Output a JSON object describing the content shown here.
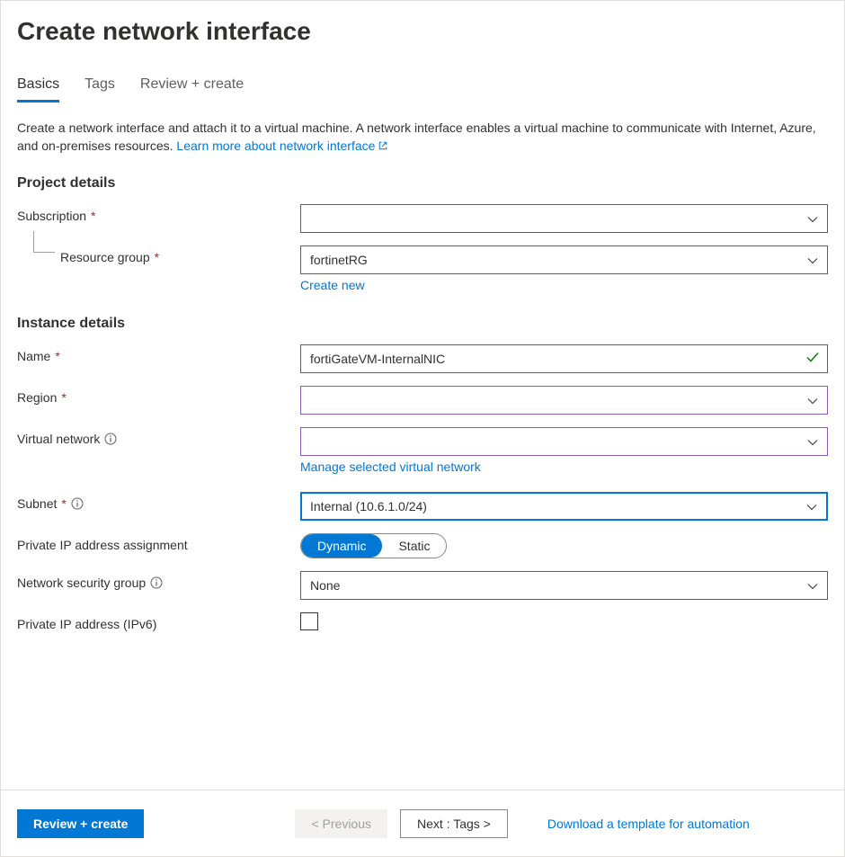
{
  "page_title": "Create network interface",
  "tabs": {
    "basics": "Basics",
    "tags": "Tags",
    "review": "Review + create"
  },
  "description": {
    "text": "Create a network interface and attach it to a virtual machine. A network interface enables a virtual machine to communicate with Internet, Azure, and on-premises resources. ",
    "link": "Learn more about network interface"
  },
  "sections": {
    "project_details": "Project details",
    "instance_details": "Instance details"
  },
  "fields": {
    "subscription": {
      "label": "Subscription",
      "value": ""
    },
    "resource_group": {
      "label": "Resource group",
      "value": "fortinetRG",
      "create_new": "Create new"
    },
    "name": {
      "label": "Name",
      "value": "fortiGateVM-InternalNIC"
    },
    "region": {
      "label": "Region",
      "value": ""
    },
    "vnet": {
      "label": "Virtual network",
      "value": "",
      "manage_link": "Manage selected virtual network"
    },
    "subnet": {
      "label": "Subnet",
      "value": "Internal (10.6.1.0/24)"
    },
    "ip_assignment": {
      "label": "Private IP address assignment",
      "option_dynamic": "Dynamic",
      "option_static": "Static"
    },
    "nsg": {
      "label": "Network security group",
      "value": "None"
    },
    "ipv6": {
      "label": "Private IP address (IPv6)"
    }
  },
  "footer": {
    "review_create": "Review + create",
    "previous": "< Previous",
    "next": "Next : Tags >",
    "download": "Download a template for automation"
  }
}
